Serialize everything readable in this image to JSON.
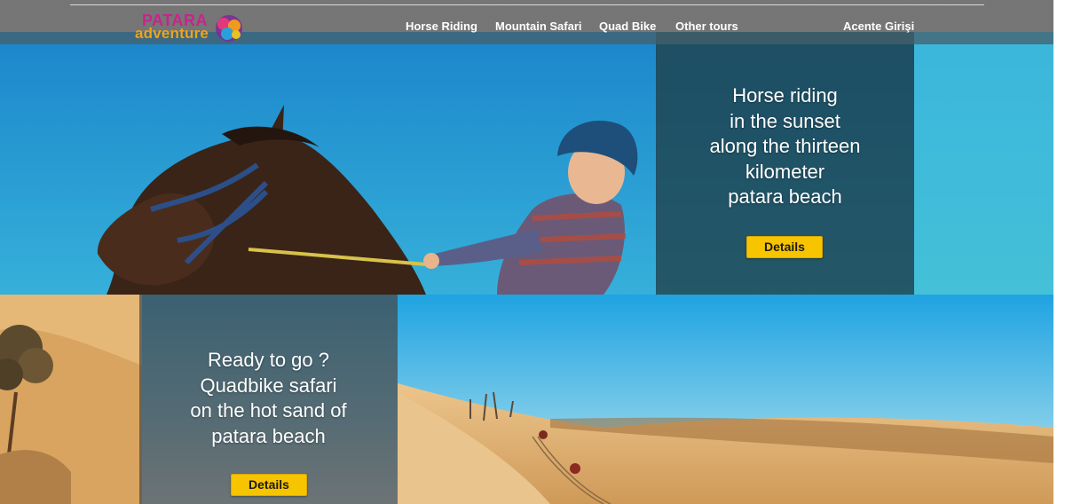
{
  "header": {
    "logo": {
      "line1": "PATARA",
      "line2": "adventure",
      "brand_pink": "#c8248a",
      "brand_orange": "#f0a21a"
    },
    "nav": {
      "horse_riding": "Horse Riding",
      "mountain_safari": "Mountain Safari",
      "quad_bike": "Quad Bike",
      "other_tours": "Other tours",
      "agency_login": "Acente Girişi"
    }
  },
  "hero_horse": {
    "lines": [
      "Horse riding",
      "in the sunset",
      "along the thirteen",
      "kilometer",
      "patara beach"
    ],
    "button_label": "Details"
  },
  "hero_quad": {
    "lines": [
      "Ready to go ?",
      "Quadbike safari",
      "on the hot sand of",
      "patara beach"
    ],
    "button_label": "Details"
  },
  "colors": {
    "button_yellow": "#f7c400",
    "sky_blue": "#2aa6d8",
    "sand": "#d9a966"
  }
}
